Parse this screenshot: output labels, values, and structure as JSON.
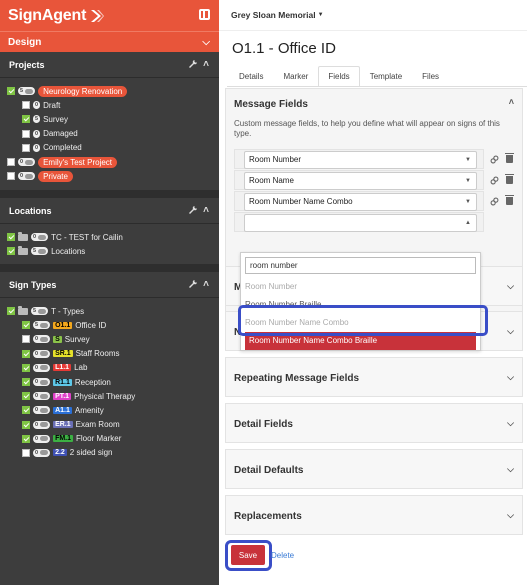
{
  "app": {
    "brand": "SignAgent",
    "colors": {
      "accent": "#e8553a",
      "sidebar_bg": "#3d3d3d",
      "danger": "#c8323a",
      "highlight": "#3a4ec7"
    }
  },
  "sidebar": {
    "design_label": "Design",
    "projects": {
      "title": "Projects",
      "items": [
        {
          "label": "Neurology Renovation",
          "count": "5",
          "checked": true,
          "level": 0,
          "style": "pill"
        },
        {
          "label": "Draft",
          "count": "0",
          "checked": false,
          "level": 1,
          "style": "plain"
        },
        {
          "label": "Survey",
          "count": "5",
          "checked": true,
          "level": 1,
          "style": "plain"
        },
        {
          "label": "Damaged",
          "count": "0",
          "checked": false,
          "level": 1,
          "style": "plain"
        },
        {
          "label": "Completed",
          "count": "0",
          "checked": false,
          "level": 1,
          "style": "plain"
        },
        {
          "label": "Emily's Test Project",
          "count": "0",
          "checked": false,
          "level": 0,
          "style": "pill"
        },
        {
          "label": "Private",
          "count": "0",
          "checked": false,
          "level": 0,
          "style": "pill"
        }
      ]
    },
    "locations": {
      "title": "Locations",
      "items": [
        {
          "label": "TC - TEST for Cailin",
          "count": "0",
          "checked": true
        },
        {
          "label": "Locations",
          "count": "5",
          "checked": true
        }
      ]
    },
    "sign_types": {
      "title": "Sign Types",
      "root": {
        "label": "T - Types",
        "count": "5"
      },
      "items": [
        {
          "code": "O1.1",
          "label": "Office ID",
          "count": "5",
          "checked": true,
          "bg": "#f4a81d",
          "fg": "#000"
        },
        {
          "code": "S",
          "label": "Survey",
          "count": "0",
          "checked": false,
          "bg": "#8bc34a",
          "fg": "#000"
        },
        {
          "code": "SR.1",
          "label": "Staff Rooms",
          "count": "0",
          "checked": true,
          "bg": "#e6e12a",
          "fg": "#000"
        },
        {
          "code": "L1.1",
          "label": "Lab",
          "count": "0",
          "checked": true,
          "bg": "#e53935",
          "fg": "#fff"
        },
        {
          "code": "R1.1",
          "label": "Reception",
          "count": "0",
          "checked": true,
          "bg": "#5ec8e8",
          "fg": "#000"
        },
        {
          "code": "PT.1",
          "label": "Physical Therapy",
          "count": "0",
          "checked": true,
          "bg": "#e040c8",
          "fg": "#fff"
        },
        {
          "code": "A1.1",
          "label": "Amenity",
          "count": "0",
          "checked": true,
          "bg": "#2a6fd6",
          "fg": "#fff"
        },
        {
          "code": "ER.1",
          "label": "Exam Room",
          "count": "0",
          "checked": true,
          "bg": "#6a6fb5",
          "fg": "#fff"
        },
        {
          "code": "FM.1",
          "label": "Floor Marker",
          "count": "0",
          "checked": true,
          "bg": "#3cb043",
          "fg": "#000"
        },
        {
          "code": "2.2",
          "label": "2 sided sign",
          "count": "0",
          "checked": false,
          "bg": "#3f51b5",
          "fg": "#fff"
        }
      ]
    }
  },
  "header": {
    "workspace": "Grey Sloan Memorial"
  },
  "page": {
    "title": "O1.1 - Office ID",
    "tabs": [
      "Details",
      "Marker",
      "Fields",
      "Template",
      "Files"
    ],
    "active_tab": "Fields"
  },
  "message_fields": {
    "title": "Message Fields",
    "description": "Custom message fields, to help you define what will appear on signs of this type.",
    "rows": [
      {
        "value": "Room Number"
      },
      {
        "value": "Room Name"
      },
      {
        "value": "Room Number Name Combo"
      },
      {
        "value": ""
      }
    ]
  },
  "dropdown": {
    "search_value": "room number",
    "options": [
      {
        "label": "Room Number",
        "state": "disabled"
      },
      {
        "label": "Room Number Braille",
        "state": "normal"
      },
      {
        "label": "Room Number Name Combo",
        "state": "disabled"
      },
      {
        "label": "Room Number Name Combo Braille",
        "state": "selected"
      }
    ]
  },
  "sections": [
    {
      "title": "M",
      "partial": true
    },
    {
      "title": "Number of sides",
      "partial": true
    },
    {
      "title": "Repeating Message Fields"
    },
    {
      "title": "Detail Fields"
    },
    {
      "title": "Detail Defaults"
    },
    {
      "title": "Replacements"
    }
  ],
  "actions": {
    "save": "Save",
    "delete": "Delete"
  }
}
